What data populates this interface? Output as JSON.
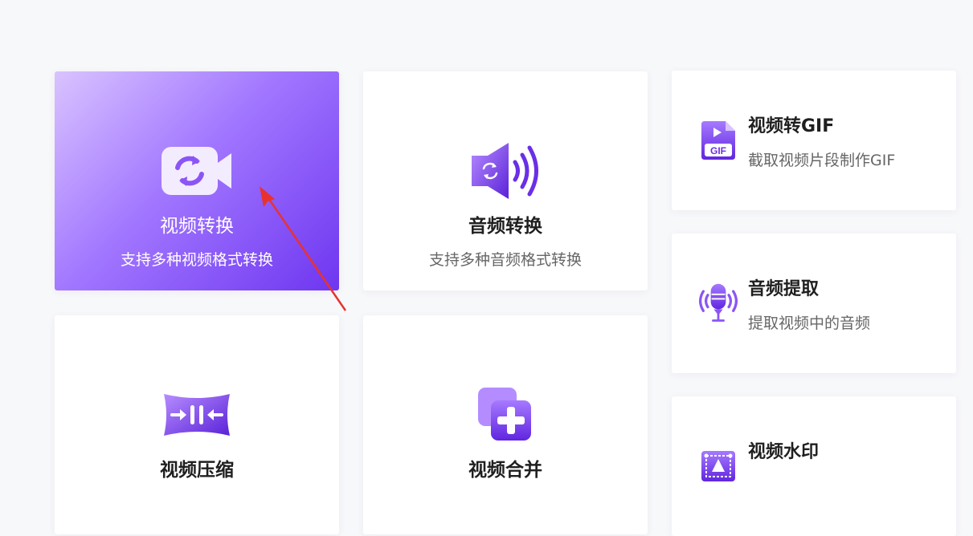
{
  "tools": {
    "video_convert": {
      "title": "视频转换",
      "desc": "支持多种视频格式转换",
      "icon": "video-convert-icon"
    },
    "audio_convert": {
      "title": "音频转换",
      "desc": "支持多种音频格式转换",
      "icon": "audio-convert-icon"
    },
    "video_to_gif": {
      "title": "视频转GIF",
      "desc": "截取视频片段制作GIF",
      "icon": "gif-file-icon",
      "icon_text": "GIF"
    },
    "audio_extract": {
      "title": "音频提取",
      "desc": "提取视频中的音频",
      "icon": "microphone-icon"
    },
    "video_compress": {
      "title": "视频压缩",
      "icon": "compress-icon"
    },
    "video_merge": {
      "title": "视频合并",
      "icon": "merge-plus-icon"
    },
    "video_watermark": {
      "title": "视频水印",
      "icon": "watermark-icon"
    }
  },
  "colors": {
    "accent": "#7b3ff2",
    "accent_dark": "#5a22d8",
    "accent_light": "#b58cff",
    "active_gradient_start": "#d9c3ff",
    "active_gradient_end": "#6e36f0",
    "annotation_arrow": "#e8322f"
  }
}
